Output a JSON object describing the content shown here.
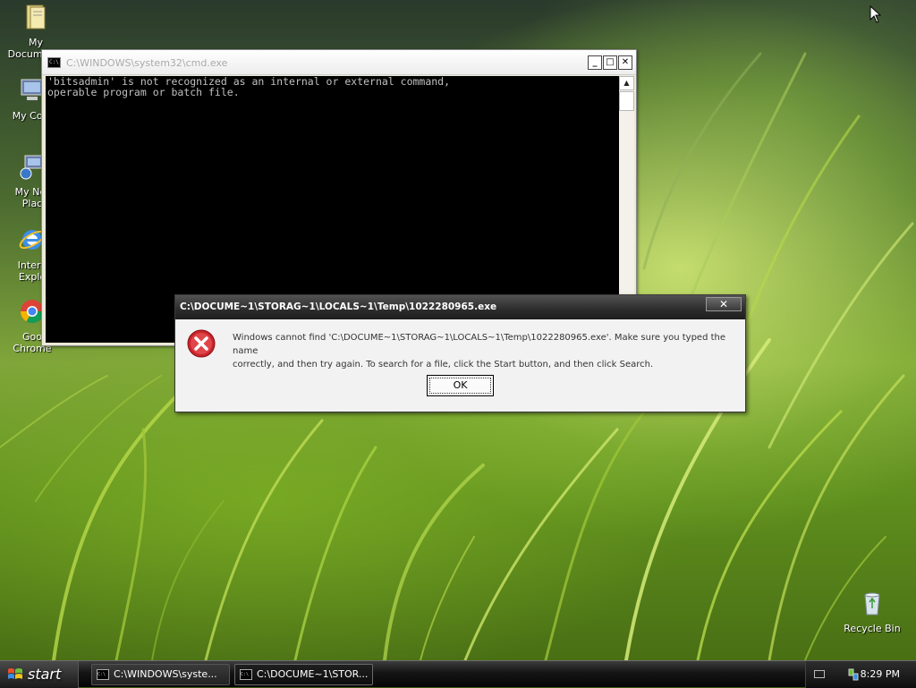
{
  "desktop": {
    "icons": [
      {
        "label": "My Documents",
        "icon": "my-documents-icon"
      },
      {
        "label": "My Com",
        "icon": "my-computer-icon"
      },
      {
        "label": "My Net",
        "label2": "Plac",
        "icon": "my-network-places-icon"
      },
      {
        "label": "Intern",
        "label2": "Explo",
        "icon": "internet-explorer-icon"
      },
      {
        "label": "Goo",
        "label2": "Chrome",
        "icon": "google-chrome-icon"
      },
      {
        "label": "Recycle Bin",
        "icon": "recycle-bin-icon"
      }
    ]
  },
  "cmd_window": {
    "title": "C:\\WINDOWS\\system32\\cmd.exe",
    "output_line1": "'bitsadmin' is not recognized as an internal or external command,",
    "output_line2": "operable program or batch file.",
    "minimize": "_",
    "maximize": "□",
    "close": "✕"
  },
  "error_dialog": {
    "title": "C:\\DOCUME~1\\STORAG~1\\LOCALS~1\\Temp\\1022280965.exe",
    "message_line1": "Windows cannot find 'C:\\DOCUME~1\\STORAG~1\\LOCALS~1\\Temp\\1022280965.exe'. Make sure you typed the name",
    "message_line2": "correctly, and then try again. To search for a file, click the Start button, and then click Search.",
    "ok_label": "OK",
    "close": "✕",
    "icon": "error-icon"
  },
  "taskbar": {
    "start_label": "start",
    "tasks": [
      {
        "label": "C:\\WINDOWS\\syste..."
      },
      {
        "label": "C:\\DOCUME~1\\STOR..."
      }
    ],
    "clock": "8:29 PM"
  },
  "colors": {
    "console_bg": "#000000",
    "console_text": "#c0c0c0",
    "dialog_title_bg": "#2c2c2c",
    "error_red": "#c8242b"
  }
}
